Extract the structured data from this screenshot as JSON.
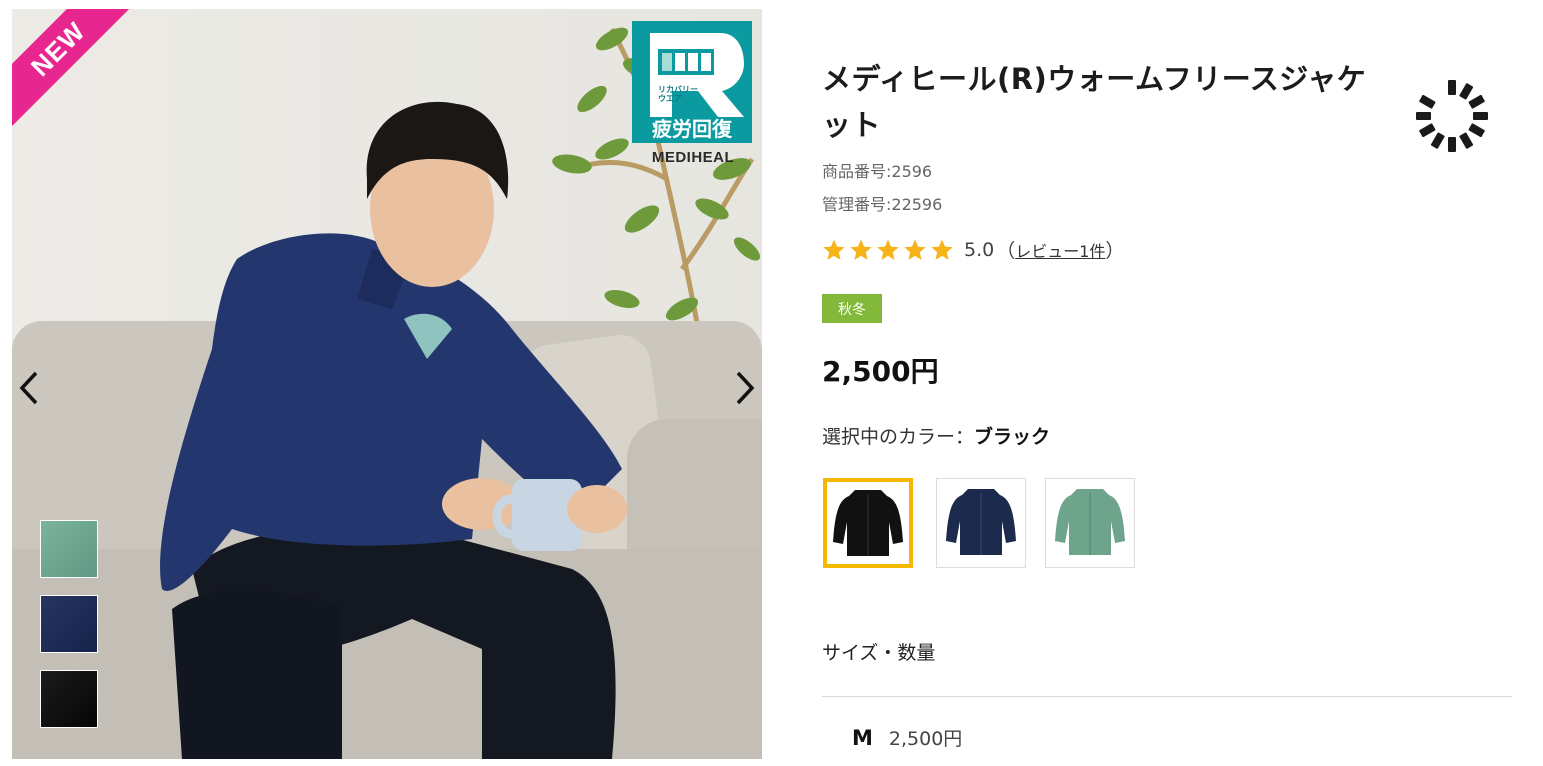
{
  "badges": {
    "new": "NEW",
    "recovery_line1": "リカバリー",
    "recovery_line2": "ウエア",
    "recovery_main": "疲労回復",
    "brand_logo": "MEDIHEAL"
  },
  "gallery": {
    "prev_icon": "chevron-left-icon",
    "next_icon": "chevron-right-icon",
    "thumbnails": [
      {
        "color_name": "green",
        "color": "#6fa78f"
      },
      {
        "color_name": "navy",
        "color": "#1f2d55"
      },
      {
        "color_name": "black",
        "color": "#111111"
      }
    ]
  },
  "product": {
    "title": "メディヒール(R)ウォームフリースジャケット",
    "product_number": "商品番号:2596",
    "management_number": "管理番号:22596",
    "rating_value": "5.0",
    "rating_stars": 5,
    "review_open": "（",
    "review_link": "レビュー1件",
    "review_close": "）",
    "season_tag": "秋冬",
    "price": "2,500円",
    "color_label": "選択中のカラー：",
    "selected_color": "ブラック",
    "swatches": [
      {
        "name": "black",
        "color": "#111111",
        "selected": true
      },
      {
        "name": "navy",
        "color": "#1c2a4d",
        "selected": false
      },
      {
        "name": "green",
        "color": "#6fa48c",
        "selected": false
      }
    ],
    "size_heading": "サイズ・数量",
    "sizes": [
      {
        "label": "M",
        "price": "2,500円"
      }
    ]
  },
  "colors": {
    "new_ribbon": "#e8268f",
    "badge_teal": "#0b9aa0",
    "star": "#f6b31a",
    "season_tag": "#83b93b",
    "swatch_selected": "#f5b800"
  }
}
